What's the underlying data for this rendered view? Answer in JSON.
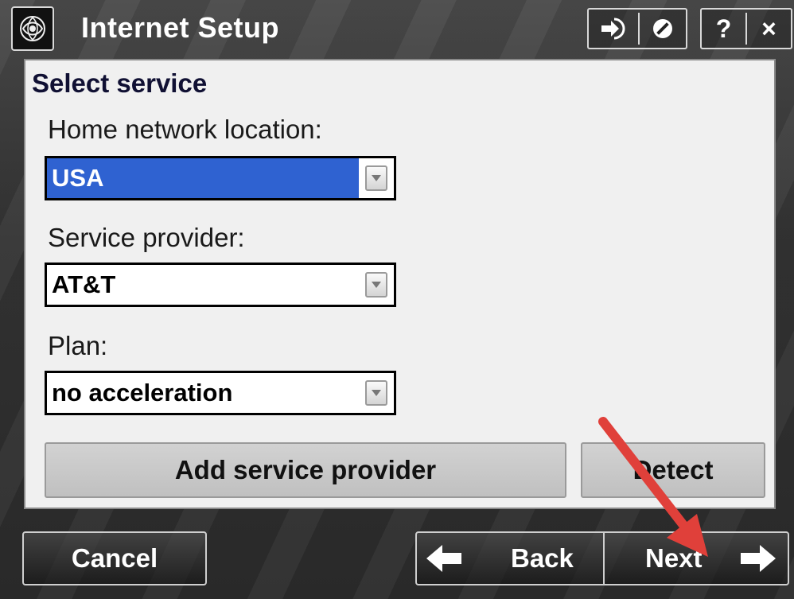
{
  "window": {
    "title": "Internet Setup",
    "toolbar": {
      "exit_icon": "arrow-into-door-icon",
      "cancel_icon": "prohibited-icon",
      "help_label": "?",
      "close_label": "×"
    }
  },
  "form": {
    "section_title": "Select service",
    "home_network": {
      "label": "Home network location:",
      "value": "USA"
    },
    "service_provider": {
      "label": "Service provider:",
      "value": "AT&T"
    },
    "plan": {
      "label": "Plan:",
      "value": "no acceleration"
    },
    "add_provider_label": "Add service provider",
    "detect_label": "Detect"
  },
  "footer": {
    "cancel_label": "Cancel",
    "back_label": "Back",
    "next_label": "Next"
  },
  "colors": {
    "selection": "#2f62d1",
    "annotation_arrow": "#e0403a"
  }
}
